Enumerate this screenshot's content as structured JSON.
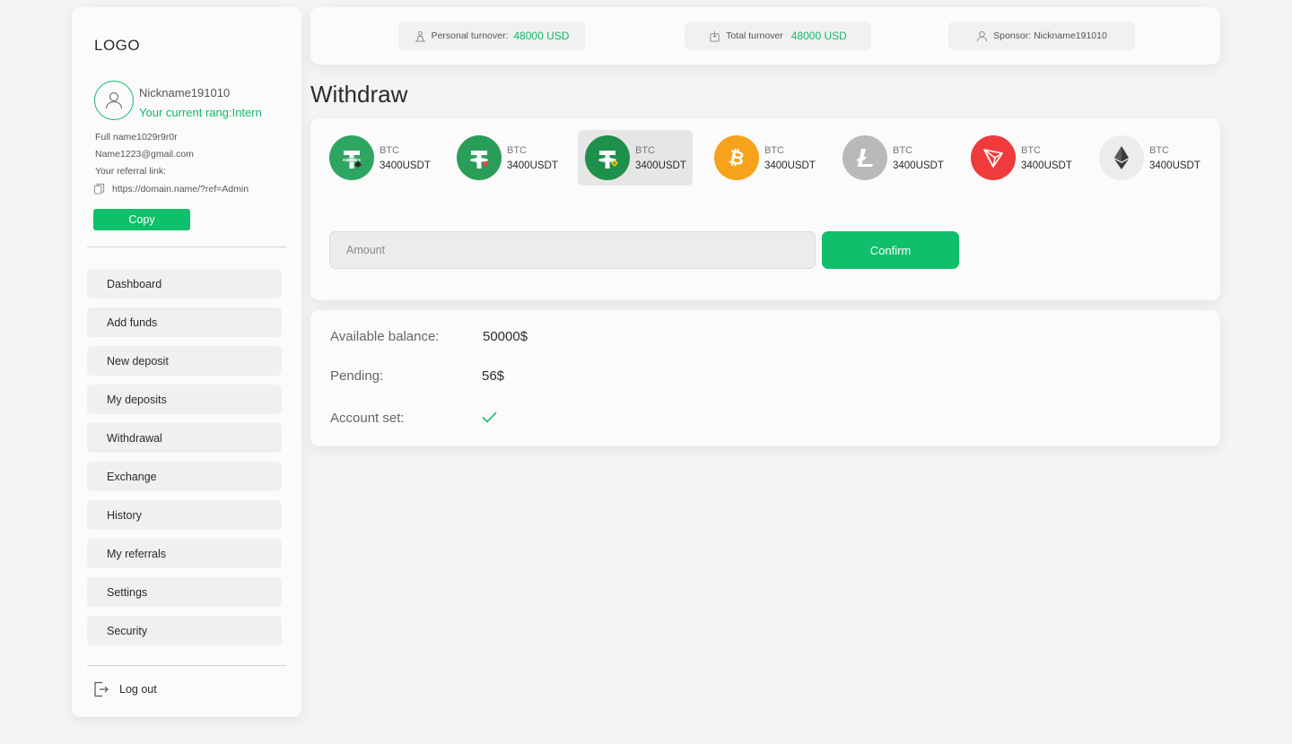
{
  "sidebar": {
    "logo": "LOGO",
    "nickname": "Nickname191010",
    "rang": "Your current rang:Intern",
    "full_name": "Full name1029r9r0r",
    "email": "Name1223@gmail.com",
    "referral_label": "Your referral link:",
    "referral_link": "https://domain.name/?ref=Admin",
    "copy_label": "Copy",
    "items": [
      {
        "label": "Dashboard"
      },
      {
        "label": "Add funds"
      },
      {
        "label": "New deposit"
      },
      {
        "label": "My deposits"
      },
      {
        "label": "Withdrawal"
      },
      {
        "label": "Exchange"
      },
      {
        "label": "History"
      },
      {
        "label": "My referrals"
      },
      {
        "label": "Settings"
      },
      {
        "label": "Security"
      }
    ],
    "logout_label": "Log out"
  },
  "topbar": {
    "personal_label": "Personal turnover:",
    "personal_value": "48000 USD",
    "total_label": "Total turnover",
    "total_value": "48000 USD",
    "sponsor_label": "Sponsor: Nickname191010"
  },
  "page": {
    "title": "Withdraw"
  },
  "coins": [
    {
      "name": "BTC",
      "amount": "3400USDT",
      "icon": "tether-erc20-icon",
      "color": "#2fa562",
      "selected": false
    },
    {
      "name": "BTC",
      "amount": "3400USDT",
      "icon": "tether-trc20-icon",
      "color": "#2a9d59",
      "selected": false
    },
    {
      "name": "BTC",
      "amount": "3400USDT",
      "icon": "tether-bep20-icon",
      "color": "#1f8f4c",
      "selected": true
    },
    {
      "name": "BTC",
      "amount": "3400USDT",
      "icon": "bitcoin-icon",
      "color": "#f7a21b",
      "selected": false
    },
    {
      "name": "BTC",
      "amount": "3400USDT",
      "icon": "litecoin-icon",
      "color": "#b9b9b9",
      "selected": false
    },
    {
      "name": "BTC",
      "amount": "3400USDT",
      "icon": "tron-icon",
      "color": "#ef3b3b",
      "selected": false
    },
    {
      "name": "BTC",
      "amount": "3400USDT",
      "icon": "ethereum-icon",
      "color": "#ececec",
      "selected": false
    }
  ],
  "withdraw_form": {
    "amount_placeholder": "Amount",
    "amount_value": "",
    "confirm_label": "Confirm"
  },
  "balance": {
    "available_label": "Available balance:",
    "available_value": "50000$",
    "pending_label": "Pending:",
    "pending_value": "56$",
    "account_label": "Account set:",
    "account_status_icon": "check-icon"
  },
  "colors": {
    "accent": "#10bf6b",
    "background": "#f4f4f4",
    "panel": "#fbfbfb"
  }
}
